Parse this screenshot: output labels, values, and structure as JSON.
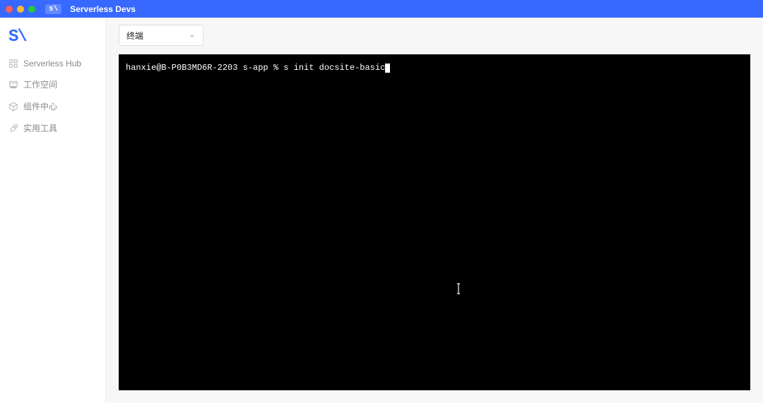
{
  "titlebar": {
    "badge": "s\\",
    "app_title": "Serverless Devs"
  },
  "sidebar": {
    "logo": "S\\",
    "items": [
      {
        "label": "Serverless Hub"
      },
      {
        "label": "工作空间"
      },
      {
        "label": "组件中心"
      },
      {
        "label": "实用工具"
      }
    ]
  },
  "main": {
    "mode_selector_label": "终端",
    "terminal": {
      "prompt": "hanxie@B-P0B3MD6R-2203 s-app % ",
      "command": "s init docsite-basic"
    }
  }
}
